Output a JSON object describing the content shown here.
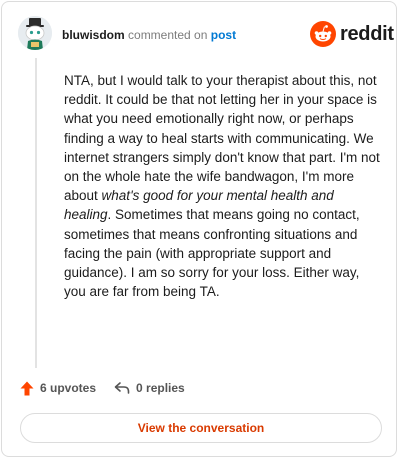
{
  "header": {
    "username": "bluwisdom",
    "action_text": "commented on",
    "post_link": "post",
    "logo_text": "reddit",
    "brand_color": "#ff4500",
    "avatar_icon": "snoo-avatar-icon"
  },
  "comment": {
    "parts": [
      "NTA, but I would talk to your therapist about this, not reddit. It could be that not letting her in your space is what you need emotionally right now, or perhaps finding a way to heal starts with communicating. We internet strangers simply don't know that part. I'm not on the whole hate the wife bandwagon, I'm more about ",
      "what's good for your mental health and healing",
      ". Sometimes that means going no contact, sometimes that means confronting situations and facing the pain (with appropriate support and guidance). I am so sorry for your loss. Either way, you are far from being TA."
    ]
  },
  "footer": {
    "upvotes_label": "6 upvotes",
    "replies_label": "0 replies",
    "upvote_icon": "upvote-arrow-icon",
    "reply_icon": "reply-arrow-icon",
    "upvote_color": "#ff4500"
  },
  "cta": {
    "label": "View the conversation",
    "color": "#d93a00"
  }
}
